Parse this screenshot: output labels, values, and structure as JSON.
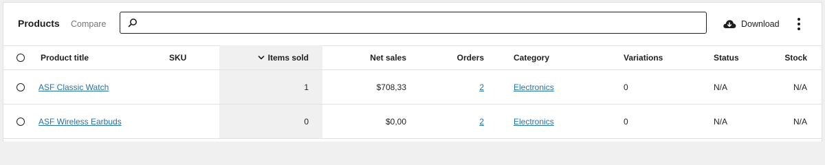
{
  "header": {
    "title": "Products",
    "compare_label": "Compare",
    "search_placeholder": "",
    "download_label": "Download"
  },
  "table": {
    "columns": {
      "product_title": "Product title",
      "sku": "SKU",
      "items_sold": "Items sold",
      "net_sales": "Net sales",
      "orders": "Orders",
      "category": "Category",
      "variations": "Variations",
      "status": "Status",
      "stock": "Stock"
    },
    "sorted_column": "items_sold",
    "sort_direction": "descending",
    "rows": [
      {
        "product_title": "ASF Classic Watch",
        "sku": "",
        "items_sold": "1",
        "net_sales": "$708,33",
        "orders": "2",
        "category": "Electronics",
        "variations": "0",
        "status": "N/A",
        "stock": "N/A"
      },
      {
        "product_title": "ASF Wireless Earbuds",
        "sku": "",
        "items_sold": "0",
        "net_sales": "$0,00",
        "orders": "2",
        "category": "Electronics",
        "variations": "0",
        "status": "N/A",
        "stock": "N/A"
      }
    ]
  },
  "icons": {
    "search": "search-icon",
    "download": "cloud-download-icon",
    "more": "more-vertical-icon",
    "sort": "chevron-down-icon"
  },
  "colors": {
    "link": "#2271b1",
    "sorted_column_bg": "#f0f0f0",
    "border": "#e0e0e0"
  }
}
